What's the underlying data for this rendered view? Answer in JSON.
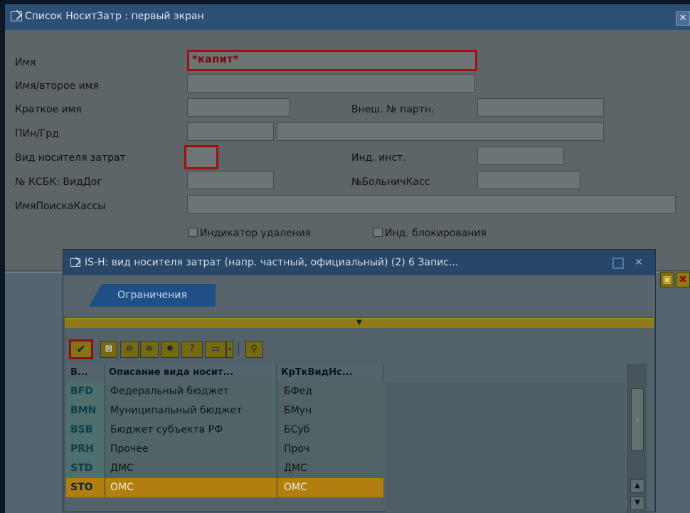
{
  "window": {
    "title": "Список НоситЗатр : первый экран",
    "close_label": "✕"
  },
  "form": {
    "name_label": "Имя",
    "name_value": "*капит*",
    "name2_label": "Имя/второе имя",
    "short_label": "Краткое имя",
    "ext_partner_label": "Внеш. № партн.",
    "zip_city_label": "ПИн/Грд",
    "carrier_type_label": "Вид носителя затрат",
    "inst_label": "Инд. инст.",
    "ksbk_label": "№ КСБК: ВидДог",
    "hospital_fund_label": "№БольничКасс",
    "search_name_label": "ИмяПоискаКассы",
    "deletion_label": "Индикатор удаления",
    "blocking_label": "Инд. блокирования"
  },
  "dialog": {
    "title": "IS-H: вид носителя затрат (напр. частный, официальный) (2)   6 Запис...",
    "tab_label": "Ограничения",
    "columns": [
      "В...",
      "Описание вида носит...",
      "КрТкВидНс..."
    ],
    "rows": [
      {
        "code": "BFD",
        "desc": "Федеральный бюджет",
        "short": "БФед"
      },
      {
        "code": "BMN",
        "desc": "Муниципальный бюджет",
        "short": "БМун"
      },
      {
        "code": "BSB",
        "desc": "Бюджет субъекта РФ",
        "short": "БСуб"
      },
      {
        "code": "PRH",
        "desc": "Прочее",
        "short": "Проч"
      },
      {
        "code": "STD",
        "desc": "ДМС",
        "short": "ДМС"
      },
      {
        "code": "STO",
        "desc": "ОМС",
        "short": "ОМС"
      }
    ],
    "selected_code": "STO"
  }
}
